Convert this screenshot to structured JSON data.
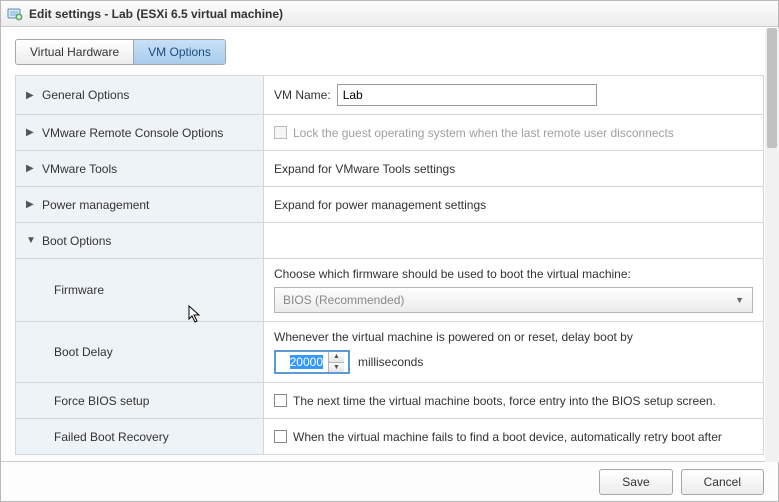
{
  "window": {
    "title": "Edit settings - Lab (ESXi 6.5 virtual machine)"
  },
  "tabs": {
    "hardware": "Virtual Hardware",
    "options": "VM Options"
  },
  "rows": {
    "general": {
      "label": "General Options",
      "vm_name_label": "VM Name:",
      "vm_name_value": "Lab"
    },
    "remote_console": {
      "label": "VMware Remote Console Options",
      "lock_text": "Lock the guest operating system when the last remote user disconnects"
    },
    "vmware_tools": {
      "label": "VMware Tools",
      "text": "Expand for VMware Tools settings"
    },
    "power_mgmt": {
      "label": "Power management",
      "text": "Expand for power management settings"
    },
    "boot_options": {
      "label": "Boot Options"
    },
    "firmware": {
      "label": "Firmware",
      "desc": "Choose which firmware should be used to boot the virtual machine:",
      "value": "BIOS (Recommended)"
    },
    "boot_delay": {
      "label": "Boot Delay",
      "desc": "Whenever the virtual machine is powered on or reset, delay boot by",
      "value": "20000",
      "unit": "milliseconds"
    },
    "force_bios": {
      "label": "Force BIOS setup",
      "text": "The next time the virtual machine boots, force entry into the BIOS setup screen."
    },
    "failed_boot": {
      "label": "Failed Boot Recovery",
      "text": "When the virtual machine fails to find a boot device, automatically retry boot after"
    }
  },
  "footer": {
    "save": "Save",
    "cancel": "Cancel"
  }
}
